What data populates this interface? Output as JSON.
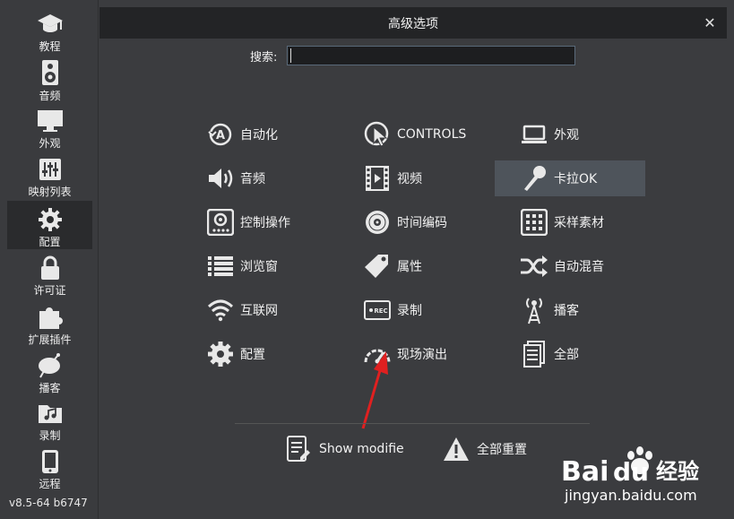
{
  "window": {
    "title": "高级选项"
  },
  "search": {
    "label": "搜索:",
    "value": ""
  },
  "sidebar": {
    "items": [
      {
        "label": "教程",
        "icon": "graduation-cap-icon"
      },
      {
        "label": "音频",
        "icon": "speaker-icon"
      },
      {
        "label": "外观",
        "icon": "monitor-icon"
      },
      {
        "label": "映射列表",
        "icon": "sliders-icon"
      },
      {
        "label": "配置",
        "icon": "gear-icon",
        "active": true
      },
      {
        "label": "许可证",
        "icon": "lock-icon"
      },
      {
        "label": "扩展插件",
        "icon": "puzzle-icon"
      },
      {
        "label": "播客",
        "icon": "satellite-dish-icon"
      },
      {
        "label": "录制",
        "icon": "music-folder-icon"
      },
      {
        "label": "远程",
        "icon": "phone-icon"
      }
    ],
    "version": "v8.5-64 b6747"
  },
  "options": [
    {
      "label": "自动化",
      "icon": "automation-icon"
    },
    {
      "label": "CONTROLS",
      "icon": "cursor-click-icon"
    },
    {
      "label": "外观",
      "icon": "laptop-icon"
    },
    {
      "label": "音频",
      "icon": "speaker-icon"
    },
    {
      "label": "视频",
      "icon": "film-icon"
    },
    {
      "label": "卡拉OK",
      "icon": "microphone-icon",
      "highlight": true
    },
    {
      "label": "控制操作",
      "icon": "mixer-icon"
    },
    {
      "label": "时间编码",
      "icon": "vinyl-icon"
    },
    {
      "label": "采样素材",
      "icon": "sampler-grid-icon"
    },
    {
      "label": "浏览窗",
      "icon": "list-icon"
    },
    {
      "label": "属性",
      "icon": "tag-icon"
    },
    {
      "label": "自动混音",
      "icon": "shuffle-icon"
    },
    {
      "label": "互联网",
      "icon": "wifi-icon"
    },
    {
      "label": "录制",
      "icon": "rec-icon"
    },
    {
      "label": "播客",
      "icon": "broadcast-icon"
    },
    {
      "label": "配置",
      "icon": "gear-icon"
    },
    {
      "label": "现场演出",
      "icon": "gauge-icon"
    },
    {
      "label": "全部",
      "icon": "documents-icon"
    }
  ],
  "footer": {
    "show_modified": "Show modifie",
    "reset_all": "全部重置"
  },
  "watermark": {
    "brand": "Bai du 经验",
    "url": "jingyan.baidu.com"
  },
  "colors": {
    "background": "#3b3c3f",
    "titlebar": "#232426",
    "highlight": "#4e545b",
    "arrow": "#e02020"
  }
}
